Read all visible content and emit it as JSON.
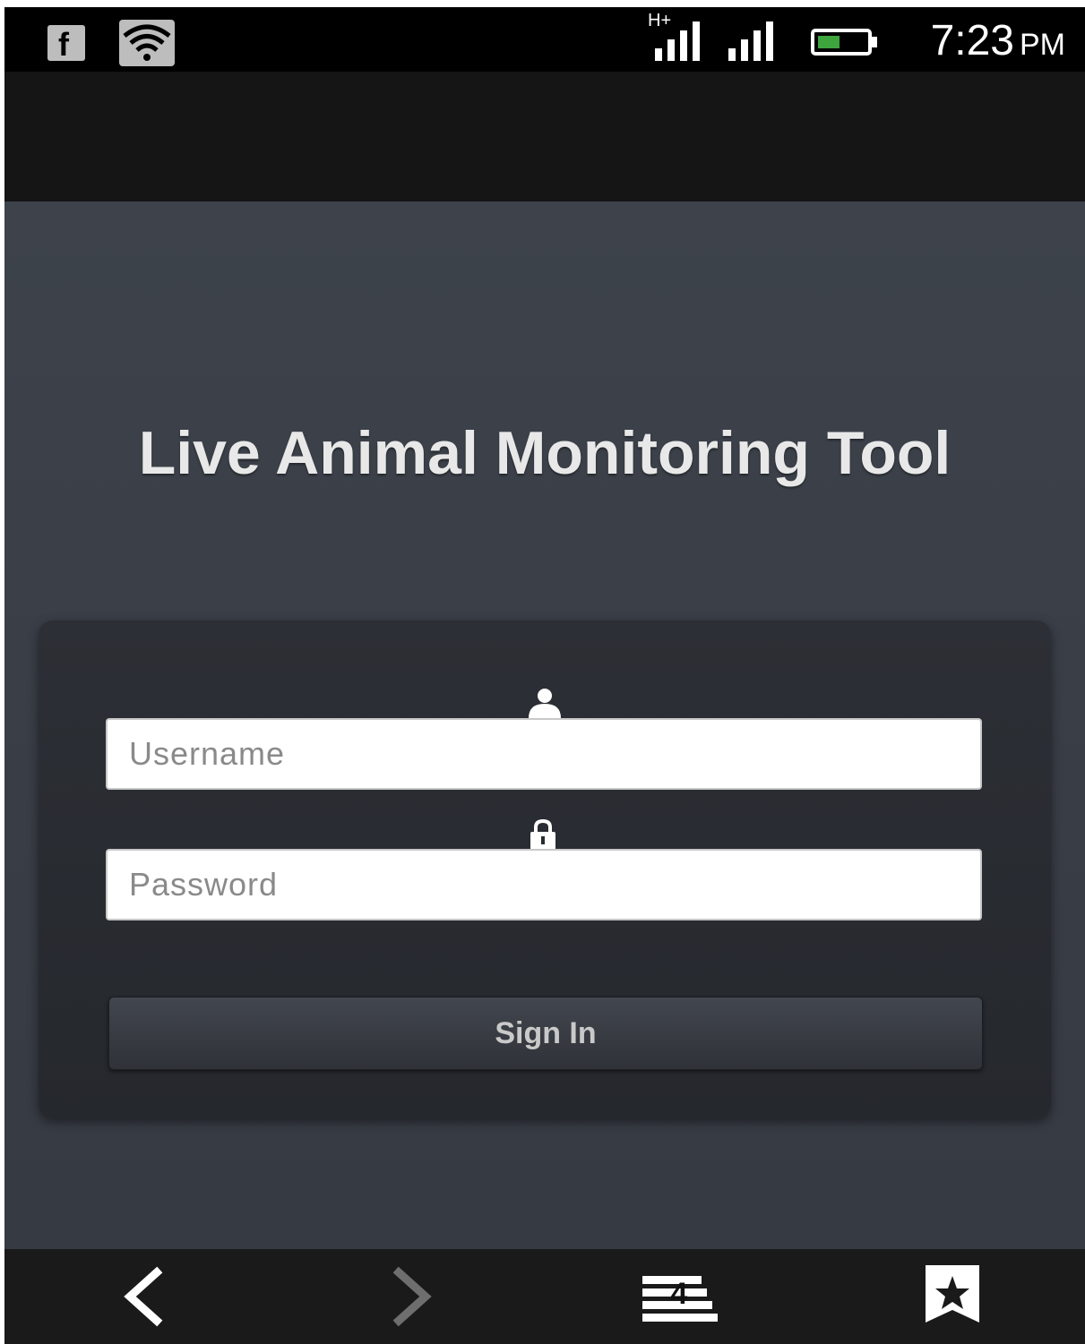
{
  "status_bar": {
    "network_type": "H+",
    "time": "7:23",
    "ampm": "PM",
    "icons": [
      "facebook-icon",
      "wifi-icon",
      "signal-icon",
      "signal-icon",
      "battery-icon"
    ]
  },
  "login": {
    "title": "Live Animal Monitoring Tool",
    "username_placeholder": "Username",
    "password_placeholder": "Password",
    "signin_label": "Sign In"
  },
  "bottom_nav": {
    "tab_count": "4",
    "icons": [
      "back-arrow-icon",
      "forward-arrow-icon",
      "tabs-icon",
      "bookmark-star-icon"
    ]
  },
  "colors": {
    "page_background": "#3a3e47",
    "panel_background": "#282b31",
    "title_text": "#e8e8e8",
    "battery_fill": "#3ea43e"
  }
}
